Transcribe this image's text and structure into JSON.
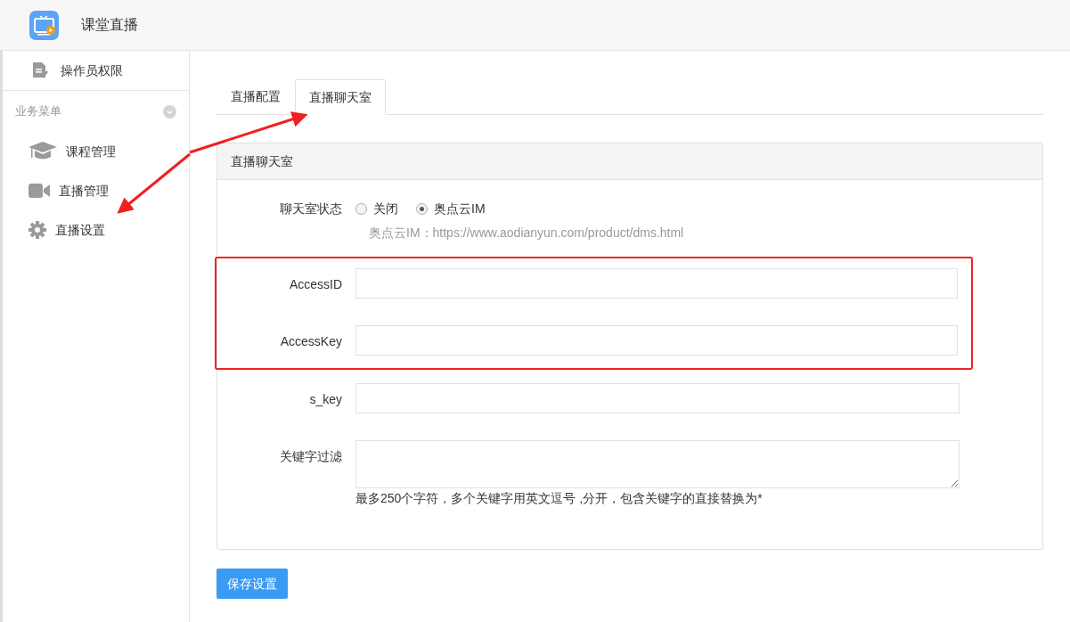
{
  "header": {
    "title": "课堂直播"
  },
  "sidebar": {
    "top_item": {
      "label": "操作员权限"
    },
    "section": {
      "label": "业务菜单",
      "expanded": true
    },
    "items": [
      {
        "label": "课程管理",
        "kind": "course"
      },
      {
        "label": "直播管理",
        "kind": "video"
      },
      {
        "label": "直播设置",
        "kind": "settings"
      }
    ]
  },
  "tabs": [
    {
      "label": "直播配置",
      "selected": false
    },
    {
      "label": "直播聊天室",
      "selected": true
    }
  ],
  "panel": {
    "title": "直播聊天室",
    "status": {
      "label": "聊天室状态",
      "options": [
        {
          "label": "关闭",
          "selected": false
        },
        {
          "label": "奥点云IM",
          "selected": true
        }
      ],
      "help": "奥点云IM：https://www.aodianyun.com/product/dms.html"
    },
    "fields": [
      {
        "label": "AccessID",
        "kind": "input",
        "highlighted": true
      },
      {
        "label": "AccessKey",
        "kind": "input",
        "highlighted": true
      },
      {
        "label": "s_key",
        "kind": "input",
        "highlighted": false
      },
      {
        "label": "关键字过滤",
        "kind": "textarea",
        "highlighted": false,
        "help": "最多250个字符，多个关键字用英文逗号 ,分开，包含关键字的直接替换为*"
      }
    ]
  },
  "save_button": {
    "label": "保存设置"
  }
}
